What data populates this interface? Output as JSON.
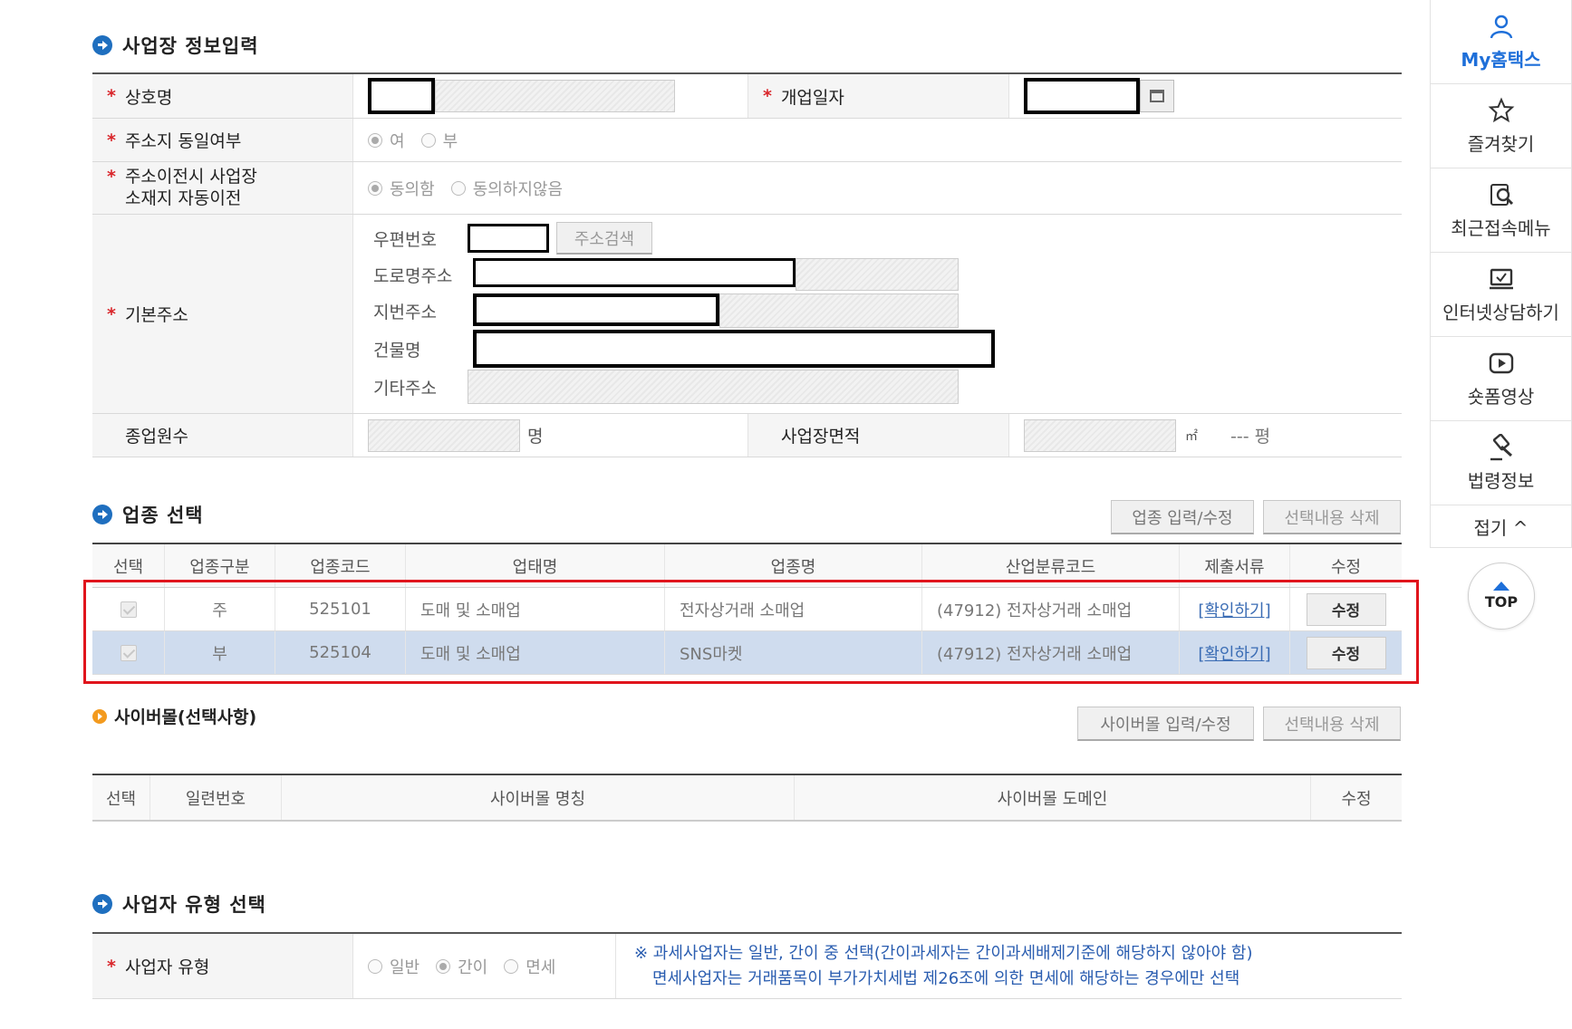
{
  "section1": {
    "title": "사업장 정보입력",
    "trade_name_label": "상호명",
    "open_date_label": "개업일자",
    "address_same_label": "주소지 동일여부",
    "address_same_opts": [
      "여",
      "부"
    ],
    "auto_transfer_label_1": "주소이전시 사업장",
    "auto_transfer_label_2": "소재지 자동이전",
    "auto_transfer_opts": [
      "동의함",
      "동의하지않음"
    ],
    "base_address_label": "기본주소",
    "postal_label": "우편번호",
    "address_search_btn": "주소검색",
    "road_label": "도로명주소",
    "lot_label": "지번주소",
    "building_label": "건물명",
    "other_label": "기타주소",
    "employees_label": "종업원수",
    "employees_unit": "명",
    "area_label": "사업장면적",
    "area_unit": "㎡",
    "pyeong": "--- 평"
  },
  "section2": {
    "title": "업종 선택",
    "btn_input": "업종 입력/수정",
    "btn_delete": "선택내용 삭제",
    "headers": [
      "선택",
      "업종구분",
      "업종코드",
      "업태명",
      "업종명",
      "산업분류코드",
      "제출서류",
      "수정"
    ],
    "rows": [
      {
        "type": "주",
        "code": "525101",
        "biz": "도매 및 소매업",
        "item": "전자상거래 소매업",
        "ind": "(47912) 전자상거래 소매업",
        "doc": "[확인하기]",
        "edit": "수정"
      },
      {
        "type": "부",
        "code": "525104",
        "biz": "도매 및 소매업",
        "item": "SNS마켓",
        "ind": "(47912) 전자상거래 소매업",
        "doc": "[확인하기]",
        "edit": "수정"
      }
    ]
  },
  "section3": {
    "title": "사이버몰(선택사항)",
    "btn_input": "사이버몰 입력/수정",
    "btn_delete": "선택내용 삭제",
    "headers": [
      "선택",
      "일련번호",
      "사이버몰 명칭",
      "사이버몰 도메인",
      "수정"
    ]
  },
  "section4": {
    "title": "사업자 유형 선택",
    "type_label": "사업자 유형",
    "opts": [
      "일반",
      "간이",
      "면세"
    ],
    "notice_1": "※ 과세사업자는 일반, 간이 중 선택(간이과세자는 간이과세배제기준에 해당하지 않아야 함)",
    "notice_2": "면세사업자는 거래품목이 부가가치세법 제26조에 의한 면세에 해당하는 경우에만 선택"
  },
  "sidebar": {
    "items": [
      "My홈택스",
      "즐겨찾기",
      "최근접속메뉴",
      "인터넷상담하기",
      "숏폼영상",
      "법령정보"
    ],
    "fold": "접기 ^",
    "top": "TOP"
  }
}
